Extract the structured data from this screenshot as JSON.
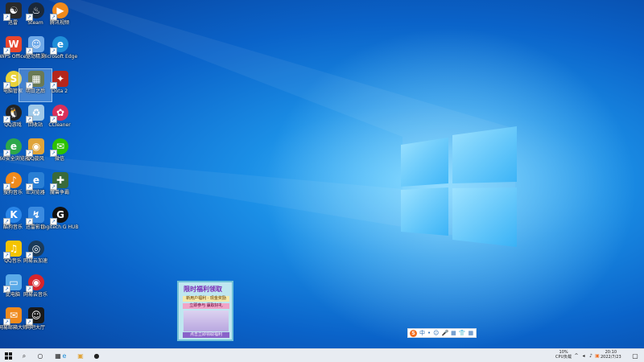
{
  "desktop_icons": [
    {
      "label": "迅雷",
      "color": "#2a2a2a",
      "glyph": "☯",
      "round": false
    },
    {
      "label": "Steam",
      "color": "#1b2838",
      "glyph": "♨",
      "round": true
    },
    {
      "label": "腾讯视频",
      "color": "#f08a1c",
      "glyph": "▶",
      "round": true
    },
    {
      "label": "WPS Office",
      "color": "#e8452c",
      "glyph": "W",
      "round": false
    },
    {
      "label": "驱动精灵",
      "color": "#6fa9e8",
      "glyph": "☺",
      "round": false
    },
    {
      "label": "Microsoft Edge",
      "color": "#1f8ed8",
      "glyph": "e",
      "round": true
    },
    {
      "label": "电脑管家",
      "color": "#e8d23a",
      "glyph": "S",
      "round": true
    },
    {
      "label": "明日之后",
      "color": "#6a7a55",
      "glyph": "▦",
      "round": false
    },
    {
      "label": "Dota 2",
      "color": "#b5261b",
      "glyph": "✦",
      "round": false
    },
    {
      "label": "QQ游戏",
      "color": "#222222",
      "glyph": "🐧",
      "round": true
    },
    {
      "label": "回收站",
      "color": "#9ec8e8",
      "glyph": "♻",
      "round": false
    },
    {
      "label": "CCleaner",
      "color": "#d9305a",
      "glyph": "✿",
      "round": true
    },
    {
      "label": "360安全浏览器",
      "color": "#2ea84a",
      "glyph": "e",
      "round": true
    },
    {
      "label": "QQ旋风",
      "color": "#e0a43a",
      "glyph": "◉",
      "round": false
    },
    {
      "label": "微信",
      "color": "#2dc100",
      "glyph": "✉",
      "round": true
    },
    {
      "label": "搜狗音乐",
      "color": "#f08a1c",
      "glyph": "♪",
      "round": true
    },
    {
      "label": "IE浏览器",
      "color": "#2a7fd4",
      "glyph": "e",
      "round": false
    },
    {
      "label": "魔兽争霸",
      "color": "#3a6a3a",
      "glyph": "✚",
      "round": false
    },
    {
      "label": "酷狗音乐",
      "color": "#2a86e8",
      "glyph": "K",
      "round": true
    },
    {
      "label": "迅雷影音",
      "color": "#3a8ae0",
      "glyph": "↯",
      "round": false
    },
    {
      "label": "Logitech G HUB",
      "color": "#111111",
      "glyph": "G",
      "round": true
    },
    {
      "label": "QQ音乐",
      "color": "#f5c400",
      "glyph": "♫",
      "round": false
    },
    {
      "label": "网易云加速",
      "color": "#1b3b5a",
      "glyph": "◎",
      "round": true
    },
    {
      "label": "此电脑",
      "color": "#5aaae8",
      "glyph": "▭",
      "round": false
    },
    {
      "label": "网易云音乐",
      "color": "#d7252c",
      "glyph": "◉",
      "round": true
    },
    {
      "label": "网易邮箱大师",
      "color": "#f08a1c",
      "glyph": "✉",
      "round": false
    },
    {
      "label": "网吧大厅",
      "color": "#1a1a1a",
      "glyph": "☺",
      "round": false
    }
  ],
  "ad_popup": {
    "title": "限时福利领取",
    "line1": "新用户福利 · 现金奖励",
    "line2": "立即参与 赢取好礼",
    "footer": "点击立即领取福利"
  },
  "ime_toolbar": {
    "logo": "S",
    "lang": "中",
    "items": [
      "•",
      "☺",
      "🎤",
      "▦",
      "👕",
      "▦"
    ]
  },
  "taskbar": {
    "start_icon": "windows-start",
    "search_icon": "⌕",
    "task_view_icon": "○",
    "apps": [
      "▦",
      "e",
      "▣",
      "●"
    ],
    "tray_line1": "10%",
    "tray_line2": "CPU负载",
    "tray_icons": [
      "^",
      "◂",
      "♪",
      "▣"
    ],
    "time": "20:10",
    "date": "2022/7/23",
    "notification_icon": "▢"
  }
}
